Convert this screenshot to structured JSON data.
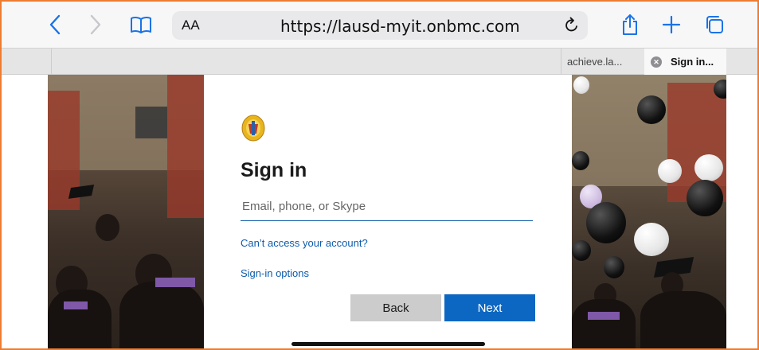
{
  "toolbar": {
    "text_size_label": "AA",
    "url": "https://lausd-myit.onbmc.com",
    "icons": [
      "back-chevron-icon",
      "forward-chevron-icon",
      "bookmarks-book-icon",
      "reload-icon",
      "share-icon",
      "new-tab-plus-icon",
      "tabs-overview-icon"
    ]
  },
  "tabs": [
    {
      "label": "achieve.la...",
      "active": false
    },
    {
      "label": "Sign in...",
      "active": true
    }
  ],
  "signin": {
    "title": "Sign in",
    "email_placeholder": "Email, phone, or Skype",
    "cant_access_link": "Can’t access your account?",
    "signin_options_link": "Sign-in options",
    "back_label": "Back",
    "next_label": "Next"
  },
  "colors": {
    "accent_blue": "#0b67c2",
    "link_blue": "#0d5cab",
    "frame_orange": "#ed7d31",
    "back_button_gray": "#cccccc"
  }
}
